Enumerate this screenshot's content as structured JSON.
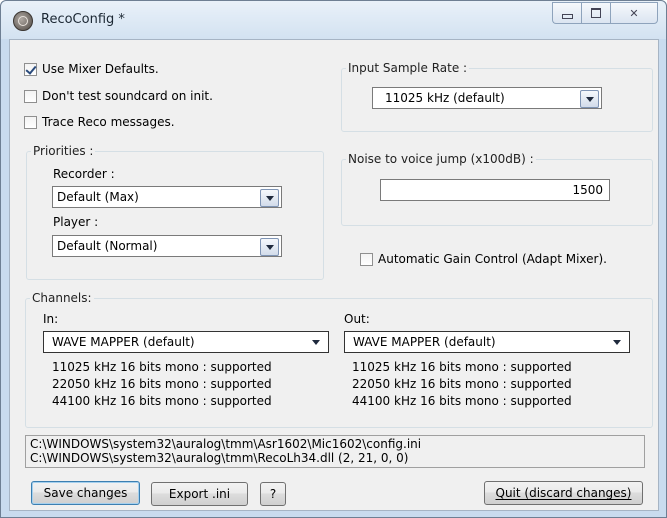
{
  "window": {
    "title": "RecoConfig *",
    "controls": {
      "minimize": "minimize",
      "maximize": "maximize",
      "close": "✕"
    }
  },
  "options": {
    "use_mixer_defaults": {
      "label": "Use Mixer Defaults.",
      "checked": true
    },
    "dont_test_soundcard": {
      "label": "Don't test soundcard on init.",
      "checked": false
    },
    "trace_reco": {
      "label": "Trace Reco messages.",
      "checked": false
    }
  },
  "priorities": {
    "label": "Priorities :",
    "recorder_label": "Recorder :",
    "recorder_value": "Default (Max)",
    "player_label": "Player :",
    "player_value": "Default (Normal)"
  },
  "input_sample_rate": {
    "label": "Input Sample Rate :",
    "value": "11025 kHz (default)"
  },
  "noise_jump": {
    "label": "Noise to voice jump (x100dB) :",
    "value": "1500"
  },
  "agc": {
    "label": "Automatic Gain Control (Adapt Mixer).",
    "checked": false
  },
  "channels": {
    "label": "Channels:",
    "in": {
      "label": "In:",
      "device": "WAVE MAPPER (default)",
      "formats": [
        "11025 kHz 16 bits mono : supported",
        "22050 kHz 16 bits mono : supported",
        "44100 kHz 16 bits mono : supported"
      ]
    },
    "out": {
      "label": "Out:",
      "device": "WAVE MAPPER (default)",
      "formats": [
        "11025 kHz 16 bits mono : supported",
        "22050 kHz 16 bits mono : supported",
        "44100 kHz 16 bits mono : supported"
      ]
    }
  },
  "paths": {
    "config": "C:\\WINDOWS\\system32\\auralog\\tmm\\Asr1602\\Mic1602\\config.ini",
    "dll": "C:\\WINDOWS\\system32\\auralog\\tmm\\RecoLh34.dll    (2, 21, 0, 0)"
  },
  "buttons": {
    "save": "Save changes",
    "export": "Export .ini",
    "help": "?",
    "quit": "Quit (discard changes)"
  }
}
